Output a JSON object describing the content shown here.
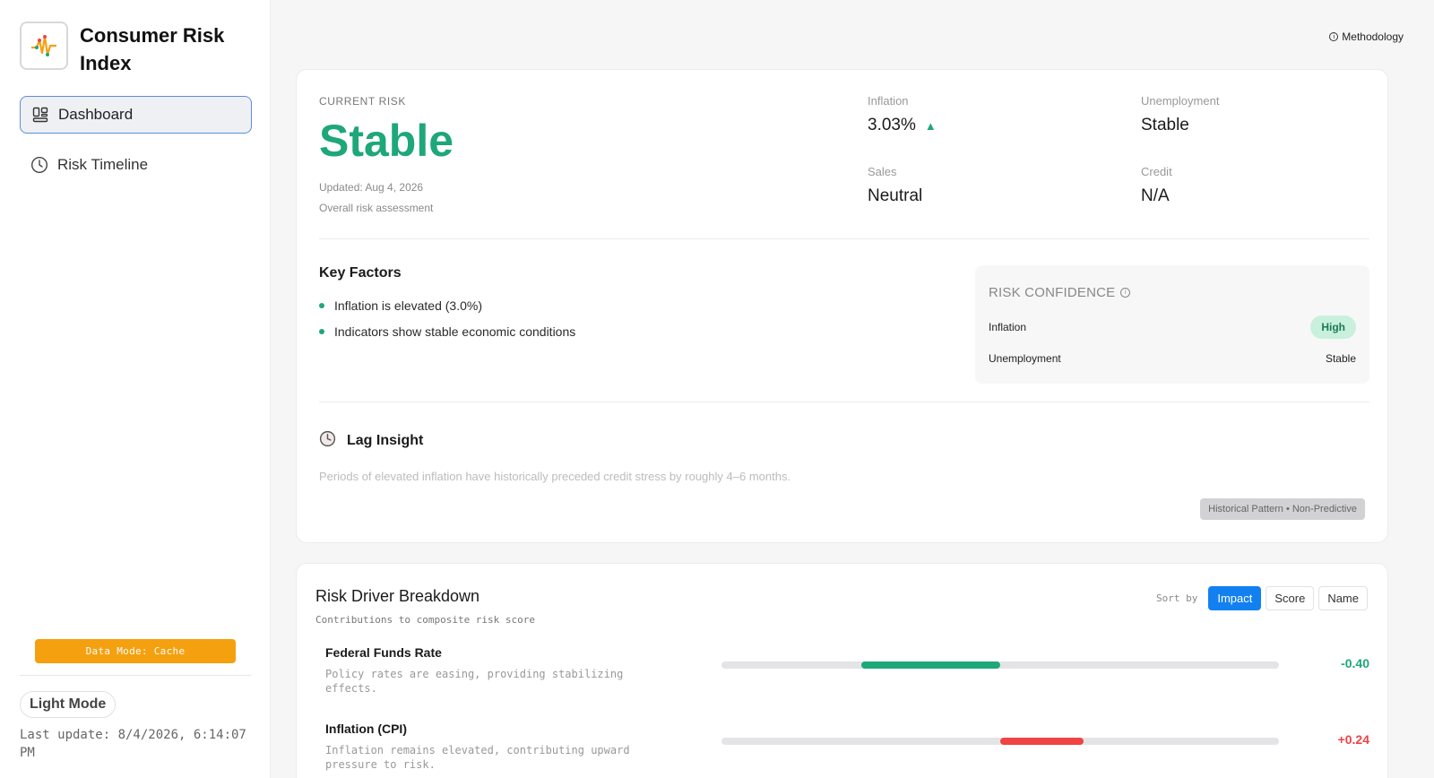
{
  "sidebar": {
    "brand_title": "Consumer Risk Index",
    "nav": [
      {
        "label": "Dashboard",
        "icon": "dashboard-icon",
        "active": true
      },
      {
        "label": "Risk Timeline",
        "icon": "clock-icon",
        "active": false
      }
    ],
    "data_mode": "Data Mode: Cache",
    "theme_toggle": "Light Mode",
    "last_update": "Last update: 8/4/2026, 6:14:07 PM"
  },
  "header": {
    "methodology": "Methodology"
  },
  "current_risk": {
    "label": "CURRENT RISK",
    "value": "Stable",
    "updated": "Updated: Aug 4, 2026",
    "caption": "Overall risk assessment"
  },
  "metrics": {
    "inflation": {
      "label": "Inflation",
      "value": "3.03%",
      "trend": "▲"
    },
    "unemployment": {
      "label": "Unemployment",
      "value": "Stable"
    },
    "sales": {
      "label": "Sales",
      "value": "Neutral"
    },
    "credit": {
      "label": "Credit",
      "value": "N/A"
    }
  },
  "key_factors": {
    "title": "Key Factors",
    "items": [
      "Inflation is elevated (3.0%)",
      "Indicators show stable economic conditions"
    ]
  },
  "confidence": {
    "title": "RISK CONFIDENCE",
    "rows": [
      {
        "label": "Inflation",
        "value": "High"
      },
      {
        "label": "Unemployment",
        "value": "Stable"
      }
    ]
  },
  "lag_insight": {
    "title": "Lag Insight",
    "text": "Periods of elevated inflation have historically preceded credit stress by roughly 4–6 months.",
    "tag": "Historical Pattern • Non-Predictive"
  },
  "breakdown": {
    "title": "Risk Driver Breakdown",
    "subtitle": "Contributions to composite risk score",
    "sort_label": "Sort by",
    "sort_options": [
      "Impact",
      "Score",
      "Name"
    ],
    "active_sort": "Impact",
    "drivers": [
      {
        "name": "Federal Funds Rate",
        "desc": "Policy rates are easing, providing stabilizing effects.",
        "value": "-0.40",
        "contribution": -0.4
      },
      {
        "name": "Inflation (CPI)",
        "desc": "Inflation remains elevated, contributing upward pressure to risk.",
        "value": "+0.24",
        "contribution": 0.24
      }
    ]
  },
  "colors": {
    "accent_green": "#1ea779",
    "negative_red": "#ef4444",
    "primary_blue": "#1380f0",
    "warning_orange": "#f5a00f"
  }
}
